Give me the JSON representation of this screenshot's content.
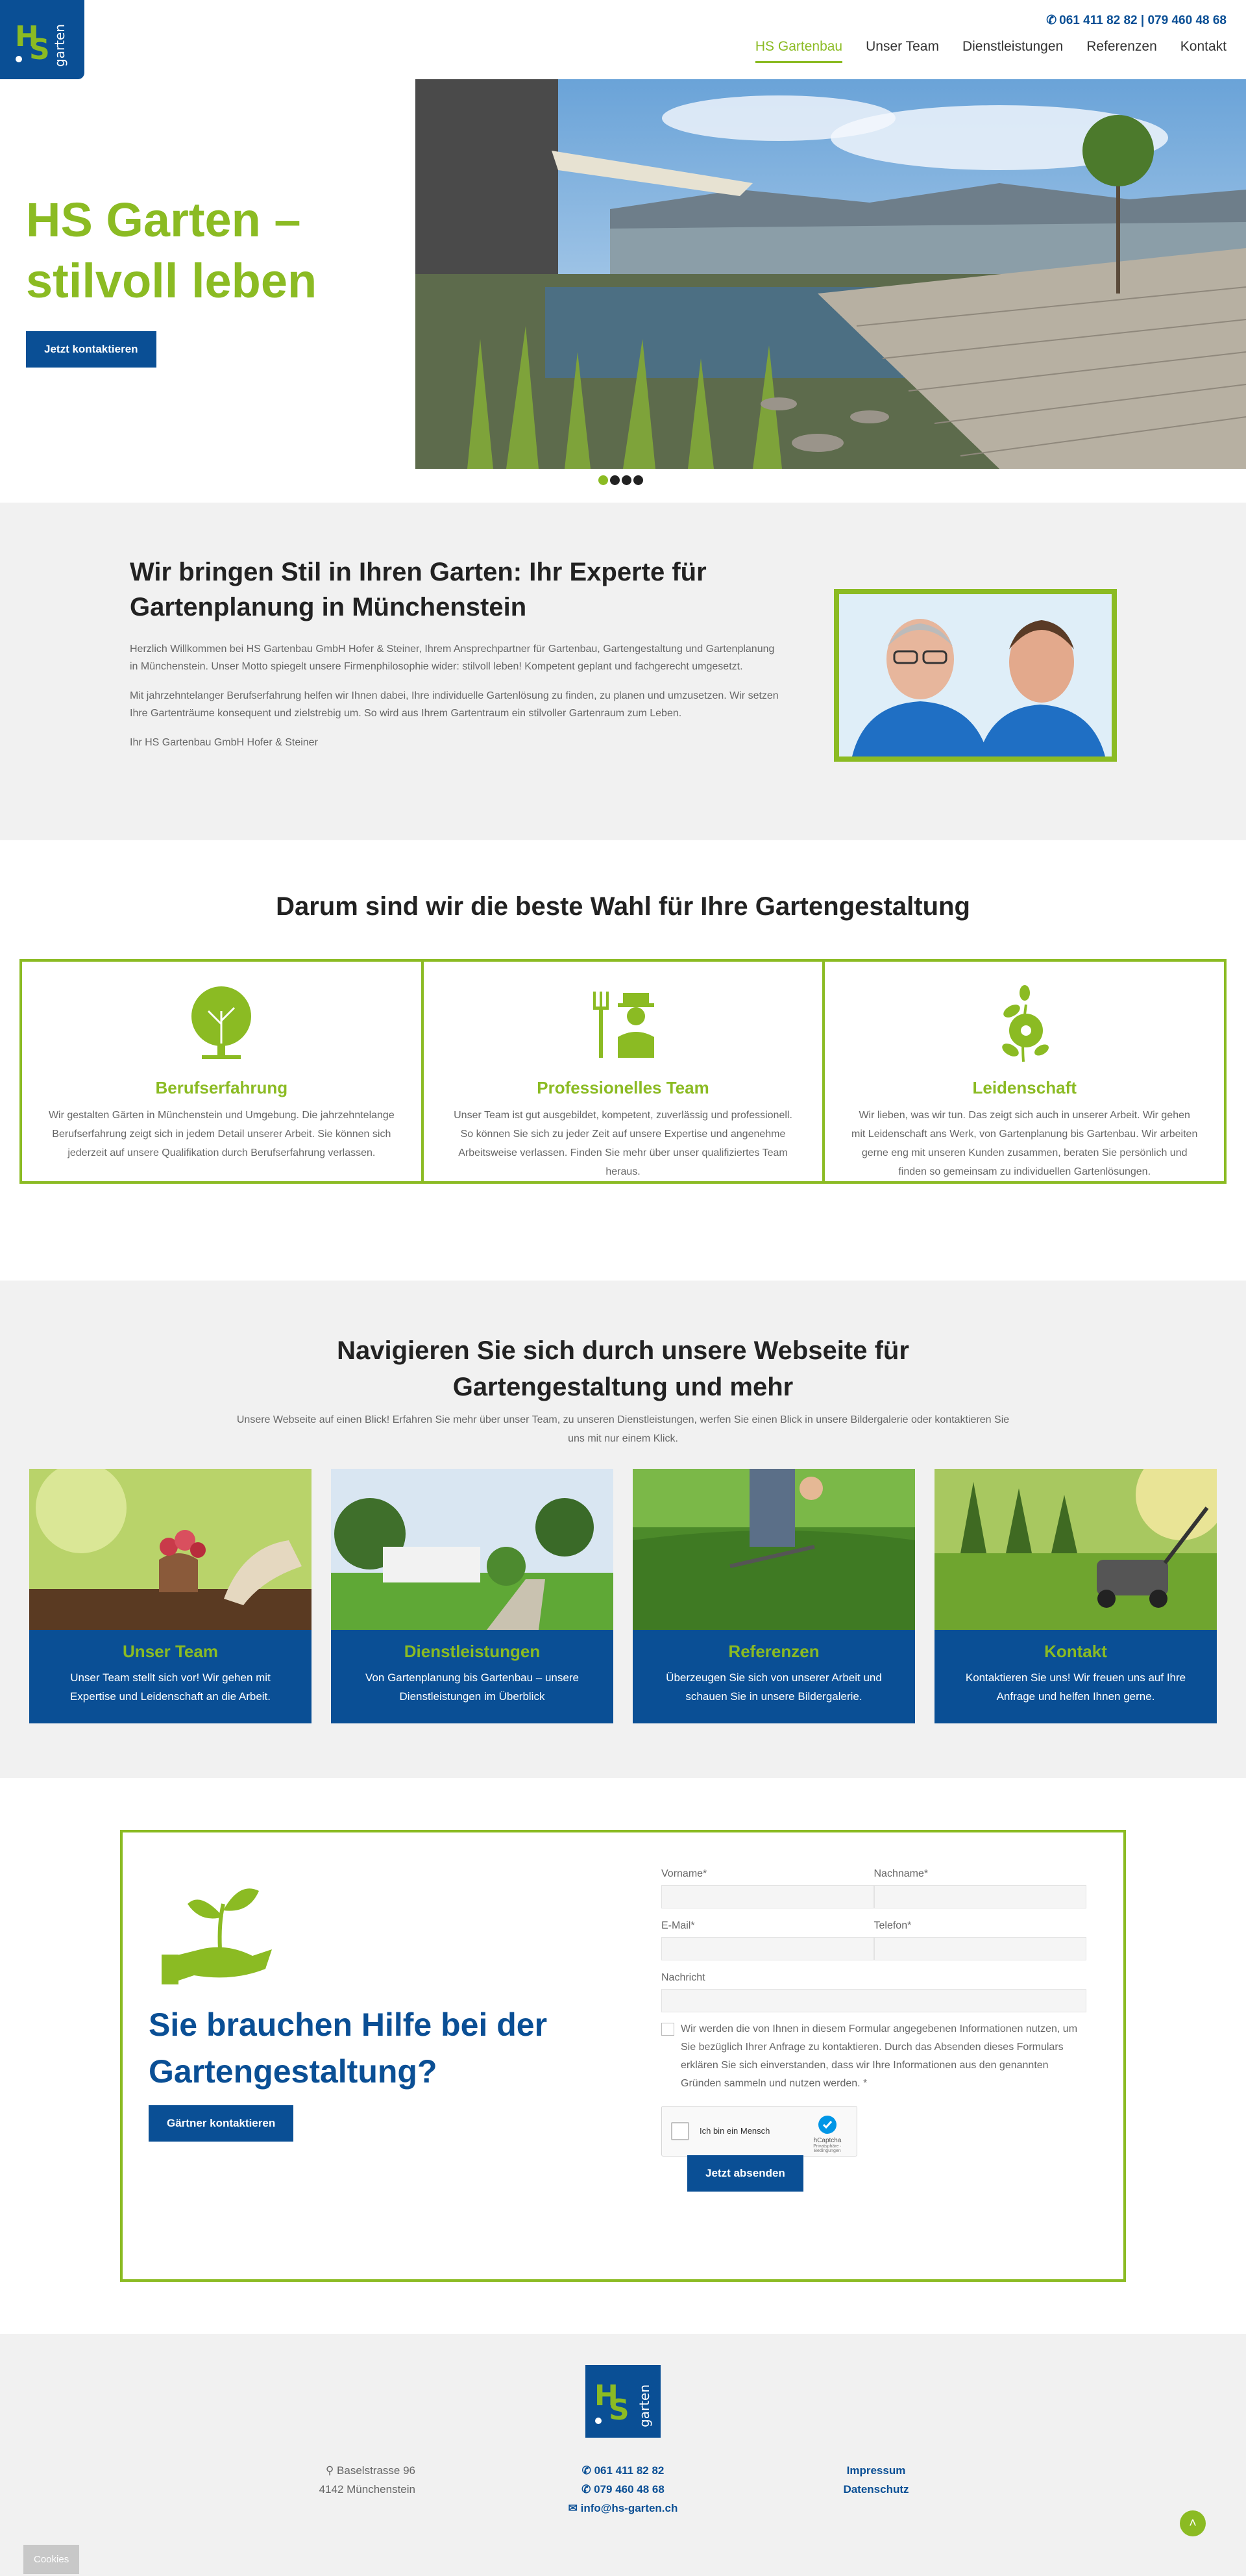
{
  "header": {
    "phones": "061 411 82 82 | 079 460 48 68",
    "nav": [
      "HS Gartenbau",
      "Unser Team",
      "Dienstleistungen",
      "Referenzen",
      "Kontakt"
    ],
    "logo_text": "garten",
    "logo_letters": "HS"
  },
  "hero": {
    "title_line1": "HS Garten –",
    "title_line2": "stilvoll leben",
    "button": "Jetzt kontaktieren"
  },
  "intro": {
    "heading": "Wir bringen Stil in Ihren Garten: Ihr Experte für Gartenplanung in Münchenstein",
    "p1": "Herzlich Willkommen bei HS Gartenbau GmbH Hofer & Steiner, Ihrem Ansprechpartner für Gartenbau, Gartengestaltung und Gartenplanung in Münchenstein. Unser Motto spiegelt unsere Firmenphilosophie wider: stilvoll leben! Kompetent geplant und fachgerecht umgesetzt.",
    "p2": "Mit jahrzehntelanger Berufserfahrung helfen wir Ihnen dabei, Ihre individuelle Gartenlösung zu finden, zu planen und umzusetzen. Wir setzen Ihre Gartenträume konsequent und zielstrebig um. So wird aus Ihrem Gartentraum ein stilvoller Gartenraum zum Leben.",
    "p3": "Ihr HS Gartenbau GmbH Hofer & Steiner"
  },
  "why": {
    "heading": "Darum sind wir die beste Wahl für Ihre Gartengestaltung",
    "boxes": [
      {
        "icon": "tree-icon",
        "title": "Berufserfahrung",
        "text": "Wir gestalten Gärten in Münchenstein und Umgebung. Die jahrzehntelange Berufserfahrung zeigt sich in jedem Detail unserer Arbeit. Sie können sich jederzeit auf unsere Qualifikation durch Berufserfahrung verlassen."
      },
      {
        "icon": "gardener-icon",
        "title": "Professionelles Team",
        "text": "Unser Team ist gut ausgebildet, kompetent, zuverlässig und professionell. So können Sie sich zu jeder Zeit auf unsere Expertise und angenehme Arbeitsweise verlassen. Finden Sie mehr über unser qualifiziertes Team heraus."
      },
      {
        "icon": "flower-icon",
        "title": "Leidenschaft",
        "text": "Wir lieben, was wir tun. Das zeigt sich auch in unserer Arbeit. Wir gehen mit Leidenschaft ans Werk, von Gartenplanung bis Gartenbau. Wir arbeiten gerne eng mit unseren Kunden zusammen, beraten Sie persönlich und finden so gemeinsam zu individuellen Gartenlösungen."
      }
    ]
  },
  "navigate": {
    "heading_line1": "Navigieren Sie sich durch unsere Webseite für",
    "heading_line2": "Gartengestaltung und mehr",
    "sub": "Unsere Webseite auf einen Blick! Erfahren Sie mehr über unser Team, zu unseren Dienstleistungen, werfen Sie einen Blick in unsere Bildergalerie oder kontaktieren Sie uns mit nur einem Klick.",
    "cards": [
      {
        "title": "Unser Team",
        "text": "Unser Team stellt sich vor! Wir gehen mit Expertise und Leidenschaft an die Arbeit."
      },
      {
        "title": "Dienstleistungen",
        "text": "Von Gartenplanung bis Gartenbau – unsere Dienstleistungen im Überblick"
      },
      {
        "title": "Referenzen",
        "text": "Überzeugen Sie sich von unserer Arbeit und schauen Sie in unsere Bildergalerie."
      },
      {
        "title": "Kontakt",
        "text": "Kontaktieren Sie uns! Wir freuen uns auf Ihre Anfrage und helfen Ihnen gerne."
      }
    ]
  },
  "contact": {
    "heading": "Sie brauchen Hilfe bei der Gartengestaltung?",
    "button": "Gärtner kontaktieren",
    "labels": {
      "vorname": "Vorname*",
      "nachname": "Nachname*",
      "email": "E-Mail*",
      "telefon": "Telefon*",
      "nachricht": "Nachricht"
    },
    "consent": "Wir werden die von Ihnen in diesem Formular angegebenen Informationen nutzen, um Sie bezüglich Ihrer Anfrage zu kontaktieren. Durch das Absenden dieses Formulars erklären Sie sich einverstanden, dass wir Ihre Informationen aus den genannten Gründen sammeln und nutzen werden. *",
    "captcha_label": "Ich bin ein Mensch",
    "captcha_brand": "hCaptcha",
    "captcha_links": "Privatsphäre · Bedingungen",
    "submit": "Jetzt absenden"
  },
  "footer": {
    "address1": "Baselstrasse 96",
    "address2": "4142 Münchenstein",
    "phone1": "061 411 82 82",
    "phone2": "079 460 48 68",
    "email": "info@hs-garten.ch",
    "impressum": "Impressum",
    "datenschutz": "Datenschutz",
    "cookies": "Cookies"
  },
  "colors": {
    "brand_blue": "#0a4f95",
    "brand_green": "#8bbb23"
  }
}
